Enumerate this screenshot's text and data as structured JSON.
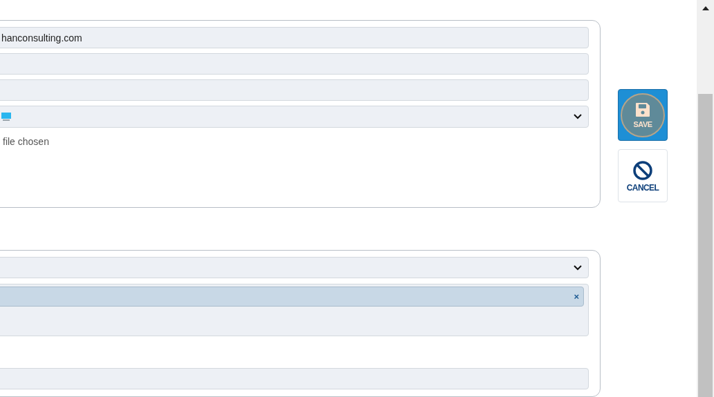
{
  "contact_panel": {
    "email": {
      "value": "hanconsulting.com"
    },
    "fields": [
      {
        "kind": "text"
      },
      {
        "kind": "text"
      }
    ],
    "device_select": {
      "kind": "select"
    },
    "file_status": "file chosen"
  },
  "tags_panel": {
    "multi_select": {
      "tags": [
        {
          "remove": "×"
        }
      ]
    }
  },
  "actions": [
    {
      "kind": "save",
      "label": "SAVE"
    },
    {
      "kind": "cancel",
      "label": "CANCEL"
    }
  ]
}
